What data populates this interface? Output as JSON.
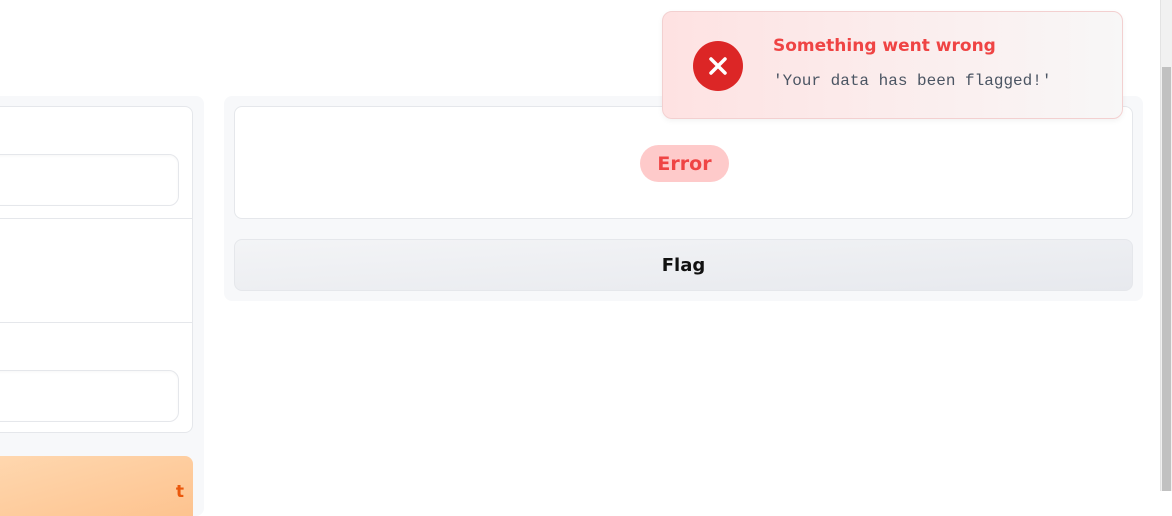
{
  "left_panel": {
    "submit_label": "t"
  },
  "right_panel": {
    "error_badge": "Error",
    "flag_button_label": "Flag"
  },
  "toast": {
    "title": "Something went wrong",
    "message": "'Your data has been flagged!'",
    "icon": "close-icon",
    "accent_color": "#dc2626",
    "title_color": "#ef4444"
  },
  "colors": {
    "submit_text": "#ea580c",
    "error_badge_bg": "#fecaca",
    "error_badge_text": "#ef4444"
  }
}
